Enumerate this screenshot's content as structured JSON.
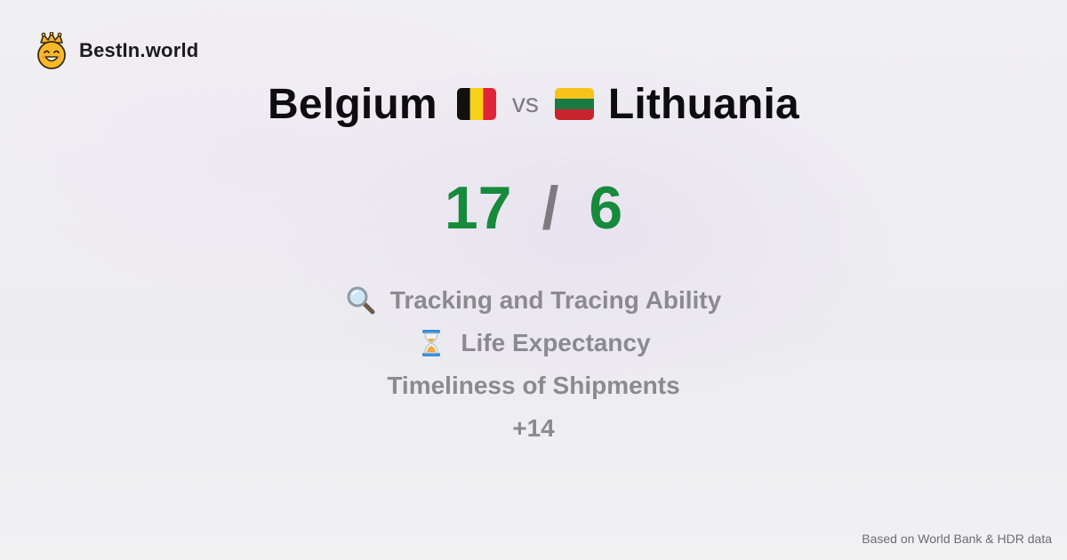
{
  "brand": {
    "name": "BestIn.world",
    "logo_icon": "crowned-smiley-icon"
  },
  "comparison": {
    "country_a": {
      "name": "Belgium",
      "flag_icon": "belgium-flag-icon"
    },
    "vs_label": "vs",
    "country_b": {
      "name": "Lithuania",
      "flag_icon": "lithuania-flag-icon"
    }
  },
  "score": {
    "a": "17",
    "separator": "/",
    "b": "6",
    "color": "#178a3c"
  },
  "features": [
    {
      "icon": "magnifying-glass-icon",
      "label": "Tracking and Tracing Ability"
    },
    {
      "icon": "hourglass-icon",
      "label": "Life Expectancy"
    },
    {
      "icon": "",
      "label": "Timeliness of Shipments"
    }
  ],
  "more_label": "+14",
  "footer": {
    "source": "Based on World Bank & HDR data"
  }
}
